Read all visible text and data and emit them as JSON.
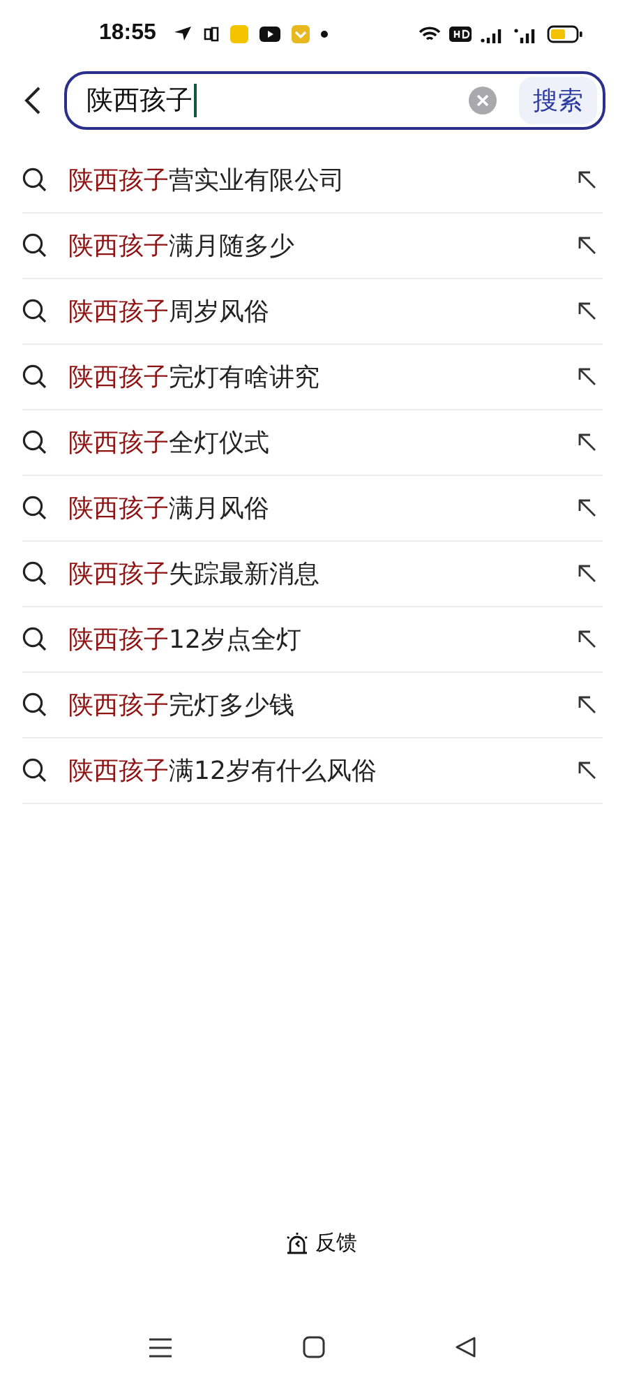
{
  "status_bar": {
    "time": "18:55"
  },
  "search": {
    "value": "陕西孩子",
    "button": "搜索"
  },
  "suggestions": [
    {
      "match": "陕西孩子",
      "rest": "营实业有限公司"
    },
    {
      "match": "陕西孩子",
      "rest": "满月随多少"
    },
    {
      "match": "陕西孩子",
      "rest": "周岁风俗"
    },
    {
      "match": "陕西孩子",
      "rest": "完灯有啥讲究"
    },
    {
      "match": "陕西孩子",
      "rest": "全灯仪式"
    },
    {
      "match": "陕西孩子",
      "rest": "满月风俗"
    },
    {
      "match": "陕西孩子",
      "rest": "失踪最新消息"
    },
    {
      "match": "陕西孩子",
      "rest": "12岁点全灯"
    },
    {
      "match": "陕西孩子",
      "rest": "完灯多少钱"
    },
    {
      "match": "陕西孩子",
      "rest": "满12岁有什么风俗"
    }
  ],
  "feedback": {
    "label": "反馈"
  }
}
